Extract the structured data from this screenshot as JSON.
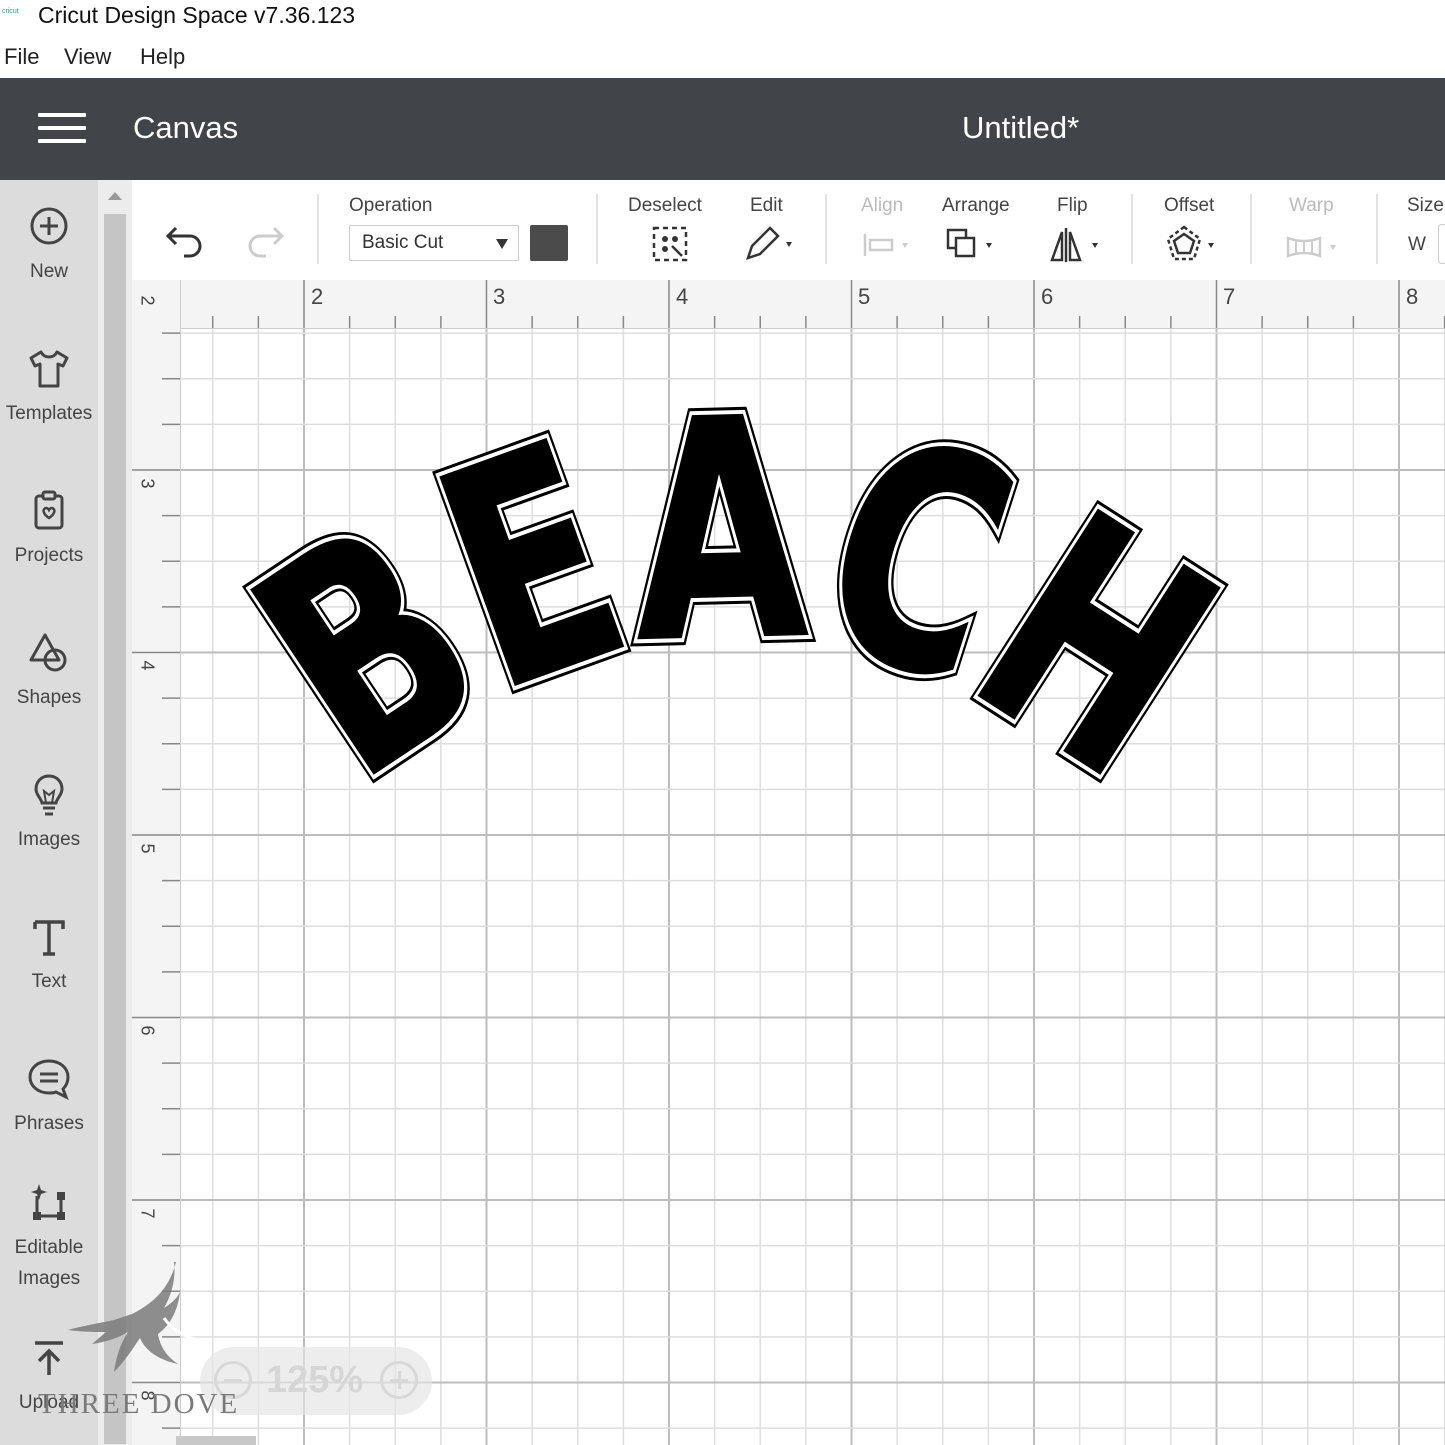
{
  "window": {
    "title": "Cricut Design Space  v7.36.123",
    "logo_text": "cricut"
  },
  "menu": [
    "File",
    "View",
    "Help"
  ],
  "header": {
    "section": "Canvas",
    "document_title": "Untitled*"
  },
  "sidebar": {
    "items": [
      {
        "label": "New",
        "icon": "plus-circle-icon"
      },
      {
        "label": "Templates",
        "icon": "tshirt-icon"
      },
      {
        "label": "Projects",
        "icon": "projects-icon"
      },
      {
        "label": "Shapes",
        "icon": "shapes-icon"
      },
      {
        "label": "Images",
        "icon": "lightbulb-icon"
      },
      {
        "label": "Text",
        "icon": "text-icon"
      },
      {
        "label": "Phrases",
        "icon": "speech-bubble-icon"
      },
      {
        "label": "Editable Images",
        "icon": "editable-images-icon"
      },
      {
        "label": "Upload",
        "icon": "upload-icon"
      }
    ]
  },
  "toolbar": {
    "operation_label": "Operation",
    "operation_value": "Basic Cut",
    "operation_color": "#4b4b4b",
    "deselect_label": "Deselect",
    "edit_label": "Edit",
    "align_label": "Align",
    "arrange_label": "Arrange",
    "flip_label": "Flip",
    "offset_label": "Offset",
    "warp_label": "Warp",
    "size_label": "Size",
    "size_w_label": "W"
  },
  "ruler": {
    "top": [
      "2",
      "3",
      "4",
      "5",
      "6",
      "7",
      "8"
    ],
    "left": [
      "2",
      "3",
      "4",
      "5",
      "6",
      "7",
      "8"
    ]
  },
  "canvas": {
    "design_text": "BEACH",
    "design_fill": "#000000",
    "design_outline": "#ffffff"
  },
  "zoom": {
    "value": "125%"
  },
  "watermark": {
    "text": "THREE DOVE"
  }
}
